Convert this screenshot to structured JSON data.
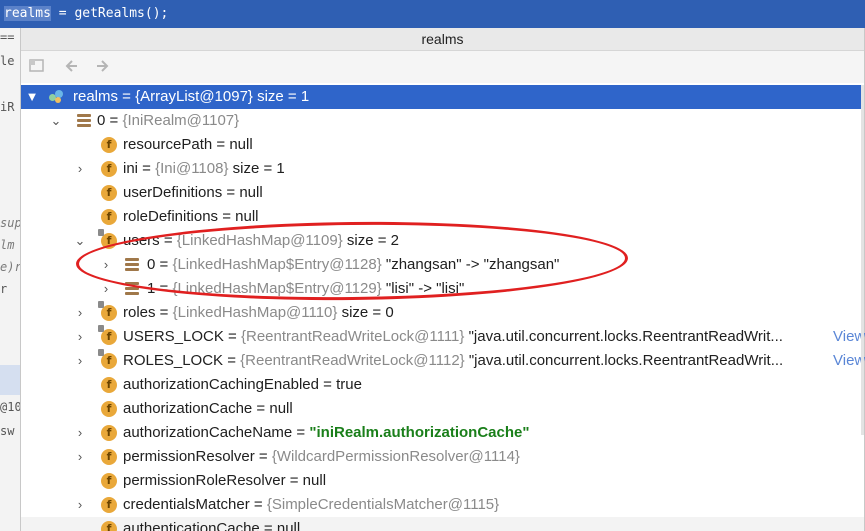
{
  "editor": {
    "code_selected": "realms",
    "code_rest": " = getRealms();"
  },
  "background_fragments": [
    "==",
    "le",
    "iR",
    "sup",
    "lm",
    "e)r",
    "r",
    "@10",
    "sw"
  ],
  "popup": {
    "title": "realms",
    "toolbar": {
      "restore_icon": "restore-layout-icon",
      "back_icon": "back-arrow-icon",
      "forward_icon": "forward-arrow-icon"
    }
  },
  "tree": {
    "root": {
      "name": "realms",
      "sep": " = ",
      "type": "{ArrayList@1097}",
      "extra": "  size = 1"
    },
    "item0": {
      "name": "0",
      "sep": " = ",
      "type": "{IniRealm@1107}"
    },
    "fields": [
      {
        "name": "resourcePath",
        "sep": " = ",
        "type": "",
        "value": "null"
      },
      {
        "name": "ini",
        "sep": " = ",
        "type": "{Ini@1108}",
        "value": "  size = 1"
      },
      {
        "name": "userDefinitions",
        "sep": " = ",
        "type": "",
        "value": "null"
      },
      {
        "name": "roleDefinitions",
        "sep": " = ",
        "type": "",
        "value": "null"
      },
      {
        "name": "users",
        "sep": " = ",
        "type": "{LinkedHashMap@1109}",
        "value": "  size = 2"
      },
      {
        "name": "0",
        "sep": " = ",
        "type": "{LinkedHashMap$Entry@1128}",
        "value": " \"zhangsan\" -> \"zhangsan\""
      },
      {
        "name": "1",
        "sep": " = ",
        "type": "{LinkedHashMap$Entry@1129}",
        "value": " \"lisi\" -> \"lisi\""
      },
      {
        "name": "roles",
        "sep": " = ",
        "type": "{LinkedHashMap@1110}",
        "value": "  size = 0"
      },
      {
        "name": "USERS_LOCK",
        "sep": " = ",
        "type": "{ReentrantReadWriteLock@1111}",
        "value": " \"java.util.concurrent.locks.ReentrantReadWrit...",
        "link": "View"
      },
      {
        "name": "ROLES_LOCK",
        "sep": " = ",
        "type": "{ReentrantReadWriteLock@1112}",
        "value": " \"java.util.concurrent.locks.ReentrantReadWrit...",
        "link": "View"
      },
      {
        "name": "authorizationCachingEnabled",
        "sep": " = ",
        "type": "",
        "value": "true"
      },
      {
        "name": "authorizationCache",
        "sep": " = ",
        "type": "",
        "value": "null"
      },
      {
        "name": "authorizationCacheName",
        "sep": " = ",
        "type": "",
        "value": "\"iniRealm.authorizationCache\""
      },
      {
        "name": "permissionResolver",
        "sep": " = ",
        "type": "{WildcardPermissionResolver@1114}",
        "value": ""
      },
      {
        "name": "permissionRoleResolver",
        "sep": " = ",
        "type": "",
        "value": "null"
      },
      {
        "name": "credentialsMatcher",
        "sep": " = ",
        "type": "{SimpleCredentialsMatcher@1115}",
        "value": ""
      },
      {
        "name": "authenticationCache",
        "sep": " = ",
        "type": "",
        "value": "null"
      }
    ]
  },
  "colors": {
    "selection": "#2f65ca",
    "field_icon": "#e9a83a",
    "string_value": "#1a7f1a",
    "highlight_circle": "#e02020"
  }
}
